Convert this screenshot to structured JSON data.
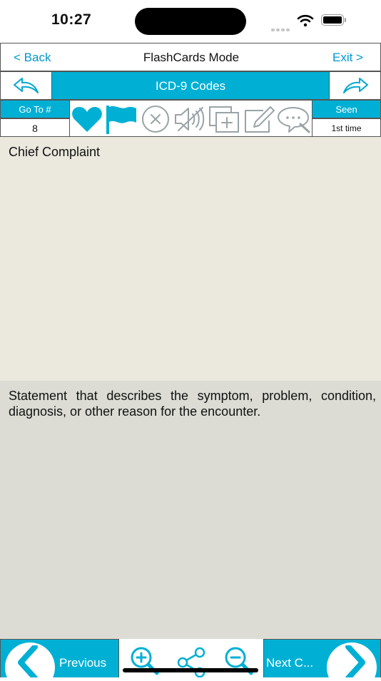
{
  "status": {
    "time": "10:27"
  },
  "nav": {
    "back_label": "< Back",
    "title": "FlashCards Mode",
    "exit_label": "Exit >"
  },
  "deck": {
    "title": "ICD-9 Codes"
  },
  "toolbar": {
    "goto_label": "Go To #",
    "goto_value": "8",
    "seen_label": "Seen",
    "seen_value": "1st time"
  },
  "card": {
    "question": "Chief Complaint",
    "answer": "Statement that describes the symptom, problem, condition, diagnosis, or other reason for the encounter."
  },
  "bottom": {
    "previous_label": "Previous",
    "next_label": "Next C..."
  },
  "colors": {
    "accent": "#00b0d4",
    "link": "#0098ce",
    "question_bg": "#ebe8de",
    "answer_bg": "#dcdcd5",
    "icon_inactive": "#9aa3a6"
  },
  "icons": [
    "heart-icon",
    "flag-icon",
    "close-circle-icon",
    "speaker-mute-icon",
    "add-card-icon",
    "edit-icon",
    "comment-icon",
    "zoom-in-icon",
    "share-icon",
    "zoom-out-icon"
  ]
}
